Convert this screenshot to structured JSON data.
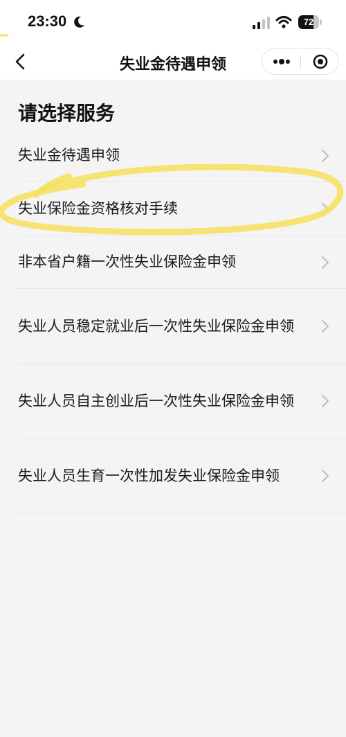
{
  "status_bar": {
    "time": "23:30",
    "battery_level": "72",
    "battery_fraction": 0.72,
    "icons": [
      "moon-icon",
      "signal-icon",
      "wifi-icon",
      "battery-icon"
    ]
  },
  "nav": {
    "title": "失业金待遇申领",
    "back_icon": "chevron-left-icon",
    "more_icon": "more-dots-icon",
    "close_icon": "target-circle-icon"
  },
  "section_title": "请选择服务",
  "services": [
    {
      "label": "失业金待遇申领"
    },
    {
      "label": "失业保险金资格核对手续"
    },
    {
      "label": "非本省户籍一次性失业保险金申领"
    },
    {
      "label": "失业人员稳定就业后一次性失业保险金申领"
    },
    {
      "label": "失业人员自主创业后一次性失业保险金申领"
    },
    {
      "label": "失业人员生育一次性加发失业保险金申领"
    }
  ],
  "colors": {
    "highlight": "#f6df5a",
    "background": "#f4f4f4",
    "text": "#1a1a1a",
    "chevron": "#bdbdbd"
  }
}
